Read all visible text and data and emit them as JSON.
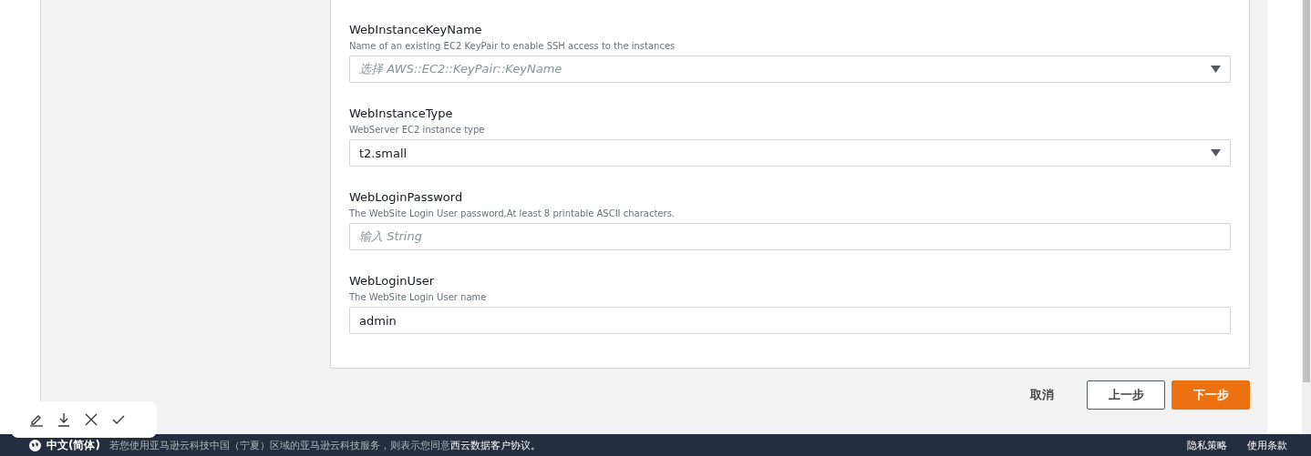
{
  "parameters": [
    {
      "name": "WebInstanceKeyName",
      "description": "Name of an existing EC2 KeyPair to enable SSH access to the instances",
      "kind": "select",
      "placeholder": "选择 AWS::EC2::KeyPair::KeyName"
    },
    {
      "name": "WebInstanceType",
      "description": "WebServer EC2 instance type",
      "kind": "select",
      "value": "t2.small"
    },
    {
      "name": "WebLoginPassword",
      "description": "The WebSite Login User password,At least 8 printable ASCII characters.",
      "kind": "input",
      "placeholder": "输入 String"
    },
    {
      "name": "WebLoginUser",
      "description": "The WebSite Login User name",
      "kind": "input",
      "value": "admin"
    }
  ],
  "actions": {
    "cancel": "取消",
    "previous": "上一步",
    "next": "下一步"
  },
  "footer": {
    "language": "中文(简体)",
    "notice": "若您使用亚马逊云科技中国（宁夏）区域的亚马逊云科技服务，则表示您同意",
    "notice_link": "西云数据客户协议。",
    "links": [
      "隐私策略",
      "使用条款"
    ]
  }
}
